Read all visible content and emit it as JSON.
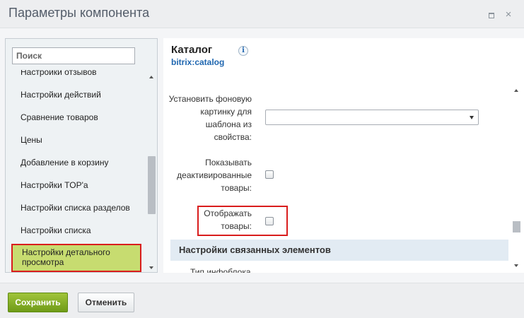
{
  "window": {
    "title": "Параметры компонента",
    "maximize_icon": "maximize-icon",
    "close_icon": "close-icon",
    "close_glyph": "×"
  },
  "sidebar": {
    "search_placeholder": "Поиск",
    "items": [
      {
        "label": "Настройки отзывов"
      },
      {
        "label": "Настройки действий"
      },
      {
        "label": "Сравнение товаров"
      },
      {
        "label": "Цены"
      },
      {
        "label": "Добавление в корзину"
      },
      {
        "label": "Настройки TOP'а"
      },
      {
        "label": "Настройки списка разделов"
      },
      {
        "label": "Настройки списка"
      },
      {
        "label": "Настройки детального просмотра",
        "active": true
      }
    ]
  },
  "component": {
    "title": "Каталог",
    "code": "bitrix:catalog",
    "info_glyph": "i"
  },
  "params": {
    "bg_image_label": "Установить фоновую картинку для шаблона из свойства:",
    "bg_image_value": "",
    "show_deactivated_label": "Показывать деактивированные товары:",
    "show_products_label": "Отображать товары:",
    "related_section": "Настройки связанных элементов",
    "iblock_type_label": "Тип инфоблока"
  },
  "footer": {
    "save": "Сохранить",
    "cancel": "Отменить"
  },
  "colors": {
    "save_button": "#7aa81f",
    "active_item": "#c7dc70",
    "highlight_border": "#d91d1d",
    "section_header": "#e2ebf3",
    "link": "#2067b0"
  }
}
